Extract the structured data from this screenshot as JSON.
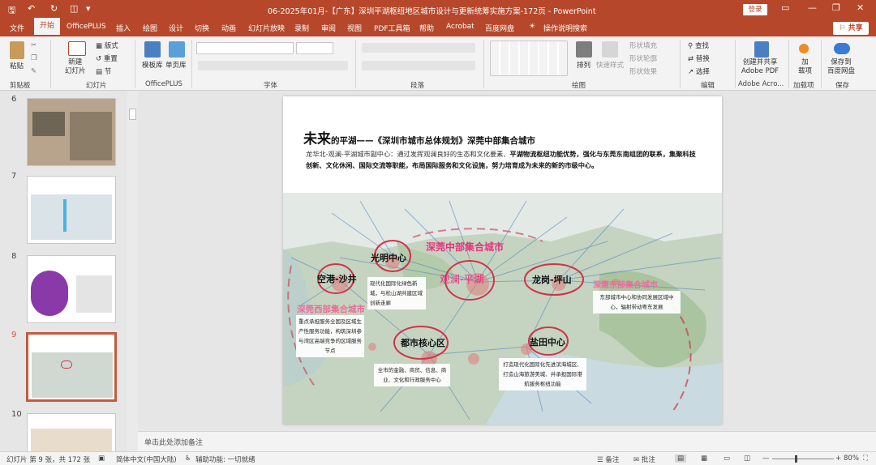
{
  "window": {
    "title": "06-2025年01月-【广东】深圳平湖枢纽地区城市设计与更新统筹实施方案-172页 - PowerPoint",
    "login": "登录"
  },
  "tabs": [
    "文件",
    "开始",
    "OfficePLUS",
    "插入",
    "绘图",
    "设计",
    "切换",
    "动画",
    "幻灯片放映",
    "录制",
    "审阅",
    "视图",
    "PDF工具箱",
    "帮助",
    "Acrobat",
    "百度网盘",
    "操作说明搜索"
  ],
  "share": "共享",
  "ribbon": {
    "clipboard": {
      "paste": "粘贴",
      "label": "剪贴板"
    },
    "slides": {
      "new_slide": "新建\n幻灯片",
      "layout": "版式",
      "reset": "重置",
      "section": "节",
      "label": "幻灯片"
    },
    "officeplus": {
      "template": "模板库",
      "single": "单页库",
      "label": "OfficePLUS"
    },
    "font": {
      "label": "字体"
    },
    "paragraph": {
      "label": "段落"
    },
    "drawing": {
      "arrange": "排列",
      "quick_style": "快速样式",
      "fill": "形状填充",
      "outline": "形状轮廓",
      "effect": "形状效果",
      "label": "绘图"
    },
    "editing": {
      "find": "查找",
      "replace": "替换",
      "select": "选择",
      "label": "编辑"
    },
    "acrobat": {
      "create": "创建并共享\nAdobe PDF",
      "label": "Adobe Acro..."
    },
    "addins": {
      "add": "加\n载项",
      "label": "加载项"
    },
    "save": {
      "save_baidu": "保存到\n百度网盘",
      "label": "保存"
    }
  },
  "thumbnails": [
    {
      "num": "6"
    },
    {
      "num": "7"
    },
    {
      "num": "8"
    },
    {
      "num": "9"
    },
    {
      "num": "10"
    }
  ],
  "slide": {
    "title_big": "未来",
    "title_rest": "的平湖——《深圳市城市总体规划》深莞中部集合城市",
    "body_plain": "龙华北-观澜-平湖城市副中心：通过发挥观澜良好的生态和文化要素、",
    "body_bold": "平湖物流枢纽功能优势，强化与东莞东南组团的联系，集聚科技创新、文化休闲、国际交流等职能，布局国际服务和文化设施，努力培育成为未来的新的市级中心。",
    "map": {
      "center_title": "深莞中部集合城市",
      "guanlan": "观澜-平湖",
      "guangming": "光明中心",
      "guangming_desc": "现代化国际化绿色新城，与松山湖共建区域创新走廊",
      "konggang": "空港-沙井",
      "west_title": "深莞西部集合城市",
      "west_desc": "重点承担服务全国及区域生产性服务功能，构筑深圳参与湾区高端竞争的区域服务节点",
      "longgang": "龙岗-坪山",
      "east_title": "深惠东部集合城市",
      "east_desc": "东部城市中心和协同发展区域中心，辐射带动粤东发展",
      "dushi": "都市核心区",
      "dushi_desc": "全市的金融、商贸、信息、商业、文化和行政服务中心",
      "yantian": "盐田中心",
      "yantian_desc": "打造现代化国际化先进滨海城区、打造山海旅游美城、并承担国际港航服务枢纽功能"
    }
  },
  "notes_placeholder": "单击此处添加备注",
  "status": {
    "slide_pos": "幻灯片 第 9 张，共 172 张",
    "language": "简体中文(中国大陆)",
    "accessibility": "辅助功能: 一切就绪",
    "notes": "备注",
    "comments": "批注",
    "zoom": "80%"
  },
  "colors": {
    "brand": "#b7472a",
    "accent_pink": "#e8327c",
    "ring": "#d0344a"
  }
}
